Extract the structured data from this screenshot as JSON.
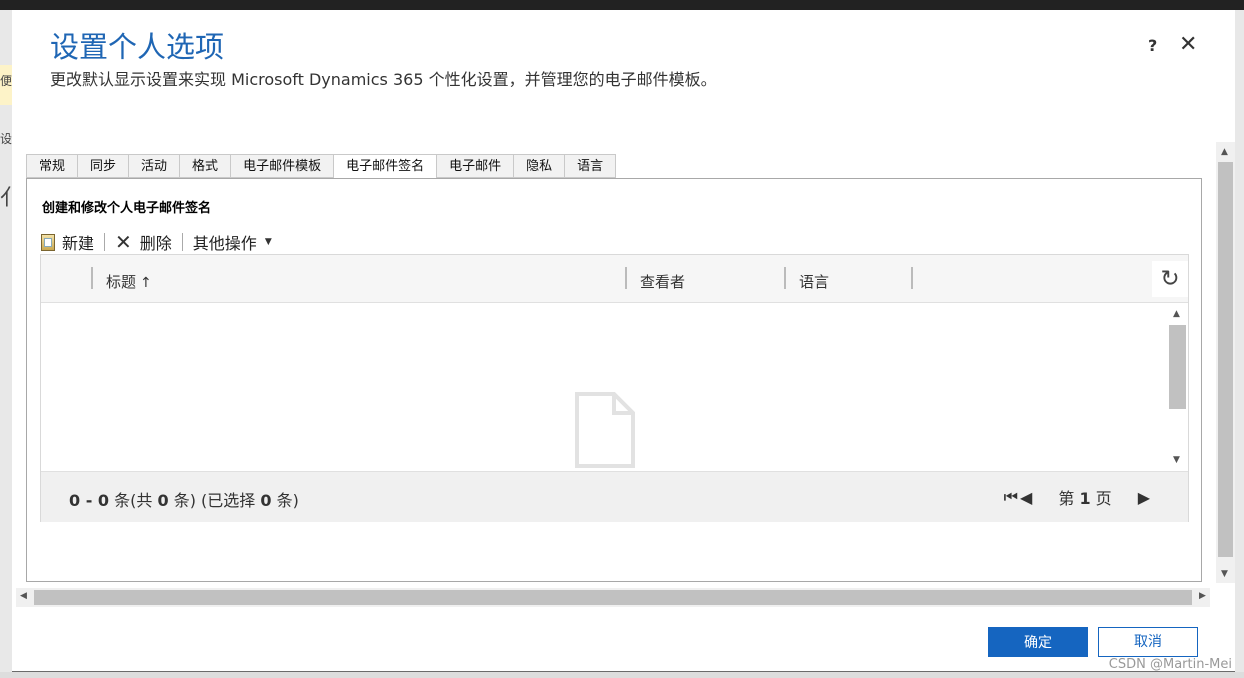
{
  "background": {
    "left_frag_1": "便",
    "left_frag_2": "设",
    "left_frag_3": "亻"
  },
  "dialog": {
    "title": "设置个人选项",
    "subtitle": "更改默认显示设置来实现 Microsoft Dynamics 365 个性化设置，并管理您的电子邮件模板。",
    "help_icon": "?",
    "close_icon": "✕",
    "tabs": [
      {
        "label": "常规",
        "active": false
      },
      {
        "label": "同步",
        "active": false
      },
      {
        "label": "活动",
        "active": false
      },
      {
        "label": "格式",
        "active": false
      },
      {
        "label": "电子邮件模板",
        "active": false
      },
      {
        "label": "电子邮件签名",
        "active": true
      },
      {
        "label": "电子邮件",
        "active": false
      },
      {
        "label": "隐私",
        "active": false
      },
      {
        "label": "语言",
        "active": false
      }
    ],
    "section_title": "创建和修改个人电子邮件签名",
    "toolbar": {
      "new_label": "新建",
      "delete_label": "删除",
      "more_label": "其他操作"
    },
    "grid": {
      "columns": [
        "标题",
        "查看者",
        "语言"
      ],
      "sort_icon": "↑",
      "refresh_icon": "↻",
      "count_text": "0 - 0 条(共 0 条) (已选择 0 条)",
      "count_parts": {
        "range": "0 - 0",
        "pre_total": "条(共",
        "total": "0",
        "mid": "条) (已选择",
        "selected": "0",
        "post": "条)"
      },
      "page_label": "第 1 页",
      "page_parts": {
        "prefix": "第",
        "num": "1",
        "suffix": "页"
      },
      "first_page_icon": "⏮",
      "prev_page_icon": "◀",
      "next_page_icon": "▶"
    },
    "buttons": {
      "ok_label": "确定",
      "cancel_label": "取消"
    }
  },
  "watermark": "CSDN @Martin-Mei",
  "colors": {
    "accent": "#1565c0",
    "title": "#1f66b4"
  }
}
